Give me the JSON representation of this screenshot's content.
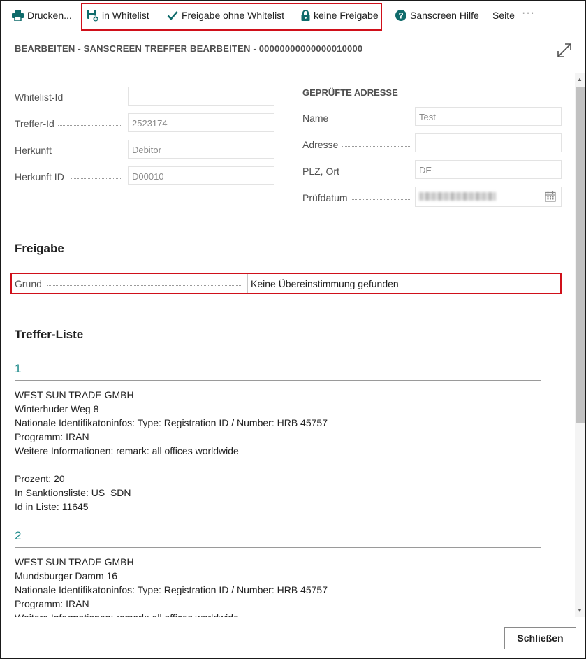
{
  "toolbar": {
    "print_label": "Drucken...",
    "whitelist_label": "in Whitelist",
    "approve_label": "Freigabe ohne Whitelist",
    "no_approve_label": "keine Freigabe",
    "help_label": "Sanscreen Hilfe",
    "page_label": "Seite",
    "more_label": "···"
  },
  "header": {
    "title": "BEARBEITEN - SANSCREEN TREFFER BEARBEITEN - 00000000000000010000"
  },
  "general": {
    "whitelist_id": {
      "label": "Whitelist-Id",
      "value": ""
    },
    "treffer_id": {
      "label": "Treffer-Id",
      "value": "2523174"
    },
    "herkunft": {
      "label": "Herkunft",
      "value": "Debitor"
    },
    "herkunft_id": {
      "label": "Herkunft ID",
      "value": "D00010"
    }
  },
  "address": {
    "title": "GEPRÜFTE ADRESSE",
    "name": {
      "label": "Name",
      "value": "Test"
    },
    "adresse": {
      "label": "Adresse",
      "value": ""
    },
    "plz_ort": {
      "label": "PLZ, Ort",
      "value": "DE-"
    },
    "pruefdatum": {
      "label": "Prüfdatum",
      "value": ""
    }
  },
  "freigabe": {
    "title": "Freigabe",
    "grund_label": "Grund",
    "grund_value": "Keine Übereinstimmung gefunden"
  },
  "treffer_liste": {
    "title": "Treffer-Liste",
    "items": [
      {
        "number": "1",
        "lines": [
          "WEST SUN TRADE GMBH",
          "Winterhuder Weg 8",
          "Nationale Identifikatoninfos: Type: Registration ID / Number: HRB 45757",
          "Programm: IRAN",
          "Weitere Informationen: remark: all offices worldwide"
        ],
        "details": [
          "Prozent: 20",
          "In Sanktionsliste: US_SDN",
          "Id in Liste: 11645"
        ]
      },
      {
        "number": "2",
        "lines": [
          "WEST SUN TRADE GMBH",
          "Mundsburger Damm 16",
          "Nationale Identifikatoninfos: Type: Registration ID / Number: HRB 45757",
          "Programm: IRAN",
          "Weitere Informationen: remark: all offices worldwide"
        ]
      }
    ]
  },
  "footer": {
    "close_label": "Schließen"
  },
  "colors": {
    "accent": "#1c8a8a",
    "highlight": "#d0101a",
    "icon": "#0f6b6b"
  },
  "icons": [
    "printer-icon",
    "whitelist-add-icon",
    "checkmark-icon",
    "lock-icon",
    "help-icon",
    "expand-icon",
    "calendar-icon"
  ]
}
